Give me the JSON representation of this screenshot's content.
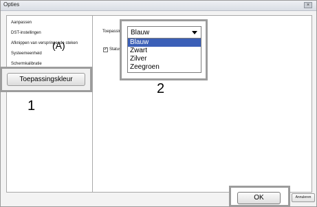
{
  "window": {
    "title": "Opties",
    "close_glyph": "×"
  },
  "sidebar": {
    "items": [
      {
        "label": "Aanpassen"
      },
      {
        "label": "DST-instellingen"
      },
      {
        "label": "Afknippen van verspringende steken"
      },
      {
        "label": "Systeemeenheid"
      },
      {
        "label": "Schermkalibratie"
      }
    ]
  },
  "main": {
    "color_label": "Toepassingskleur:",
    "status_checkbox": {
      "checked": true,
      "check_glyph": "✓",
      "label": "Statusbalk"
    }
  },
  "dropdown": {
    "selected": "Blauw",
    "options": [
      {
        "label": "Blauw"
      },
      {
        "label": "Zwart"
      },
      {
        "label": "Zilver"
      },
      {
        "label": "Zeegroen"
      }
    ]
  },
  "annotation_button": {
    "label": "Toepassingskleur"
  },
  "annotations": {
    "a": "(A)",
    "one": "1",
    "two": "2"
  },
  "footer": {
    "ok": "OK",
    "cancel": "Annuleren"
  },
  "colors": {
    "highlight": "#3b5fb7",
    "callout_border": "#9c9c9c"
  }
}
